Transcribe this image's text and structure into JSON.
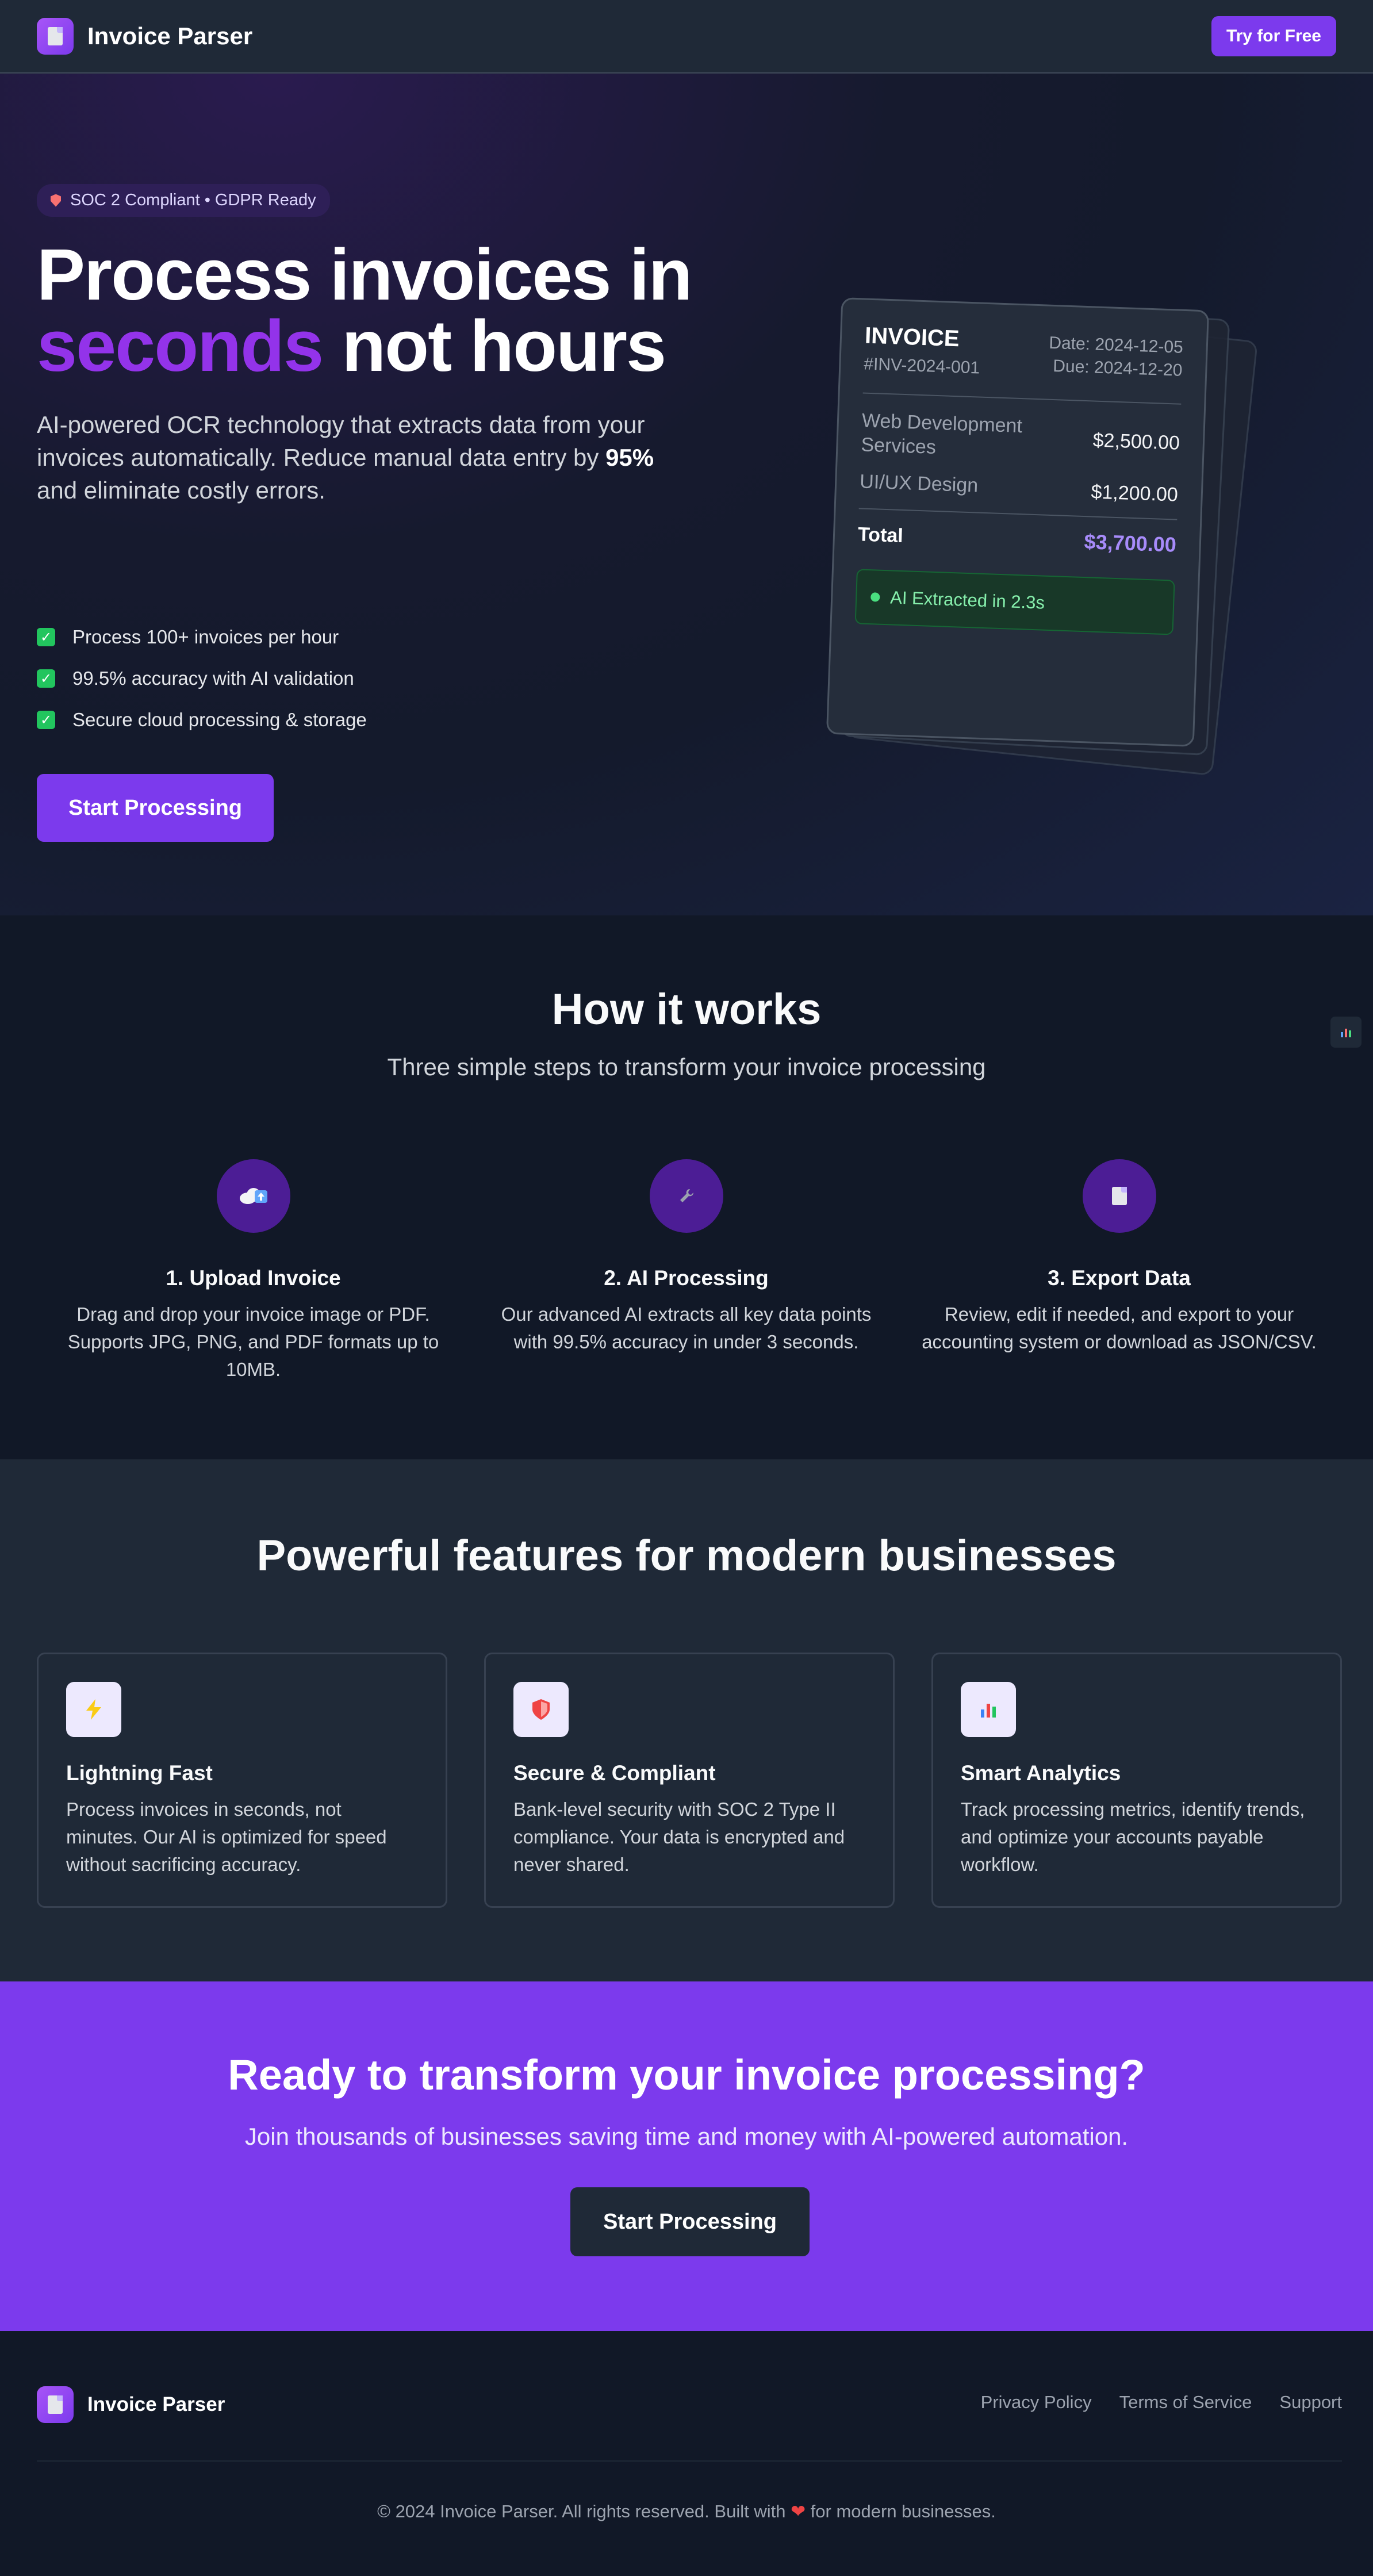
{
  "nav": {
    "brand": "Invoice Parser",
    "cta_label": "Try for Free"
  },
  "hero": {
    "badge": "SOC 2 Compliant • GDPR Ready",
    "title_line1": "Process invoices in",
    "title_accent": "seconds",
    "title_line2_rest": " not hours",
    "subtitle_pre": "AI-powered OCR technology that extracts data from your invoices automatically. Reduce manual data entry by ",
    "subtitle_bold": "95%",
    "subtitle_post": " and eliminate costly errors.",
    "checks": [
      "Process 100+ invoices per hour",
      "99.5% accuracy with AI validation",
      "Secure cloud processing & storage"
    ],
    "button_label": "Start Processing"
  },
  "invoice_card": {
    "title": "INVOICE",
    "number": "#INV-2024-001",
    "date": "Date: 2024-12-05",
    "due": "Due: 2024-12-20",
    "items": [
      {
        "name": "Web Development Services",
        "amount": "$2,500.00"
      },
      {
        "name": "UI/UX Design",
        "amount": "$1,200.00"
      }
    ],
    "total_label": "Total",
    "total_amount": "$3,700.00",
    "status": "AI Extracted in 2.3s"
  },
  "how": {
    "title": "How it works",
    "subtitle": "Three simple steps to transform your invoice processing",
    "steps": [
      {
        "icon": "cloud-upload-icon",
        "title": "1. Upload Invoice",
        "desc": "Drag and drop your invoice image or PDF. Supports JPG, PNG, and PDF formats up to 10MB."
      },
      {
        "icon": "wrench-icon",
        "title": "2. AI Processing",
        "desc": "Our advanced AI extracts all key data points with 99.5% accuracy in under 3 seconds."
      },
      {
        "icon": "document-icon",
        "title": "3. Export Data",
        "desc": "Review, edit if needed, and export to your accounting system or download as JSON/CSV."
      }
    ]
  },
  "features": {
    "title": "Powerful features for modern businesses",
    "items": [
      {
        "icon": "lightning-icon",
        "title": "Lightning Fast",
        "desc": "Process invoices in seconds, not minutes. Our AI is optimized for speed without sacrificing accuracy."
      },
      {
        "icon": "shield-icon",
        "title": "Secure & Compliant",
        "desc": "Bank-level security with SOC 2 Type II compliance. Your data is encrypted and never shared."
      },
      {
        "icon": "bar-chart-icon",
        "title": "Smart Analytics",
        "desc": "Track processing metrics, identify trends, and optimize your accounts payable workflow."
      }
    ]
  },
  "cta": {
    "title": "Ready to transform your invoice processing?",
    "subtitle": "Join thousands of businesses saving time and money with AI-powered automation.",
    "button_label": "Start Processing"
  },
  "footer": {
    "brand": "Invoice Parser",
    "links": [
      "Privacy Policy",
      "Terms of Service",
      "Support"
    ],
    "copy_pre": "© 2024 Invoice Parser. All rights reserved. Built with ",
    "copy_post": " for modern businesses."
  },
  "colors": {
    "accent": "#7c3aed",
    "accent_text": "#9333ea",
    "success": "#22c55e",
    "background": "#111827",
    "surface": "#1f2937"
  }
}
